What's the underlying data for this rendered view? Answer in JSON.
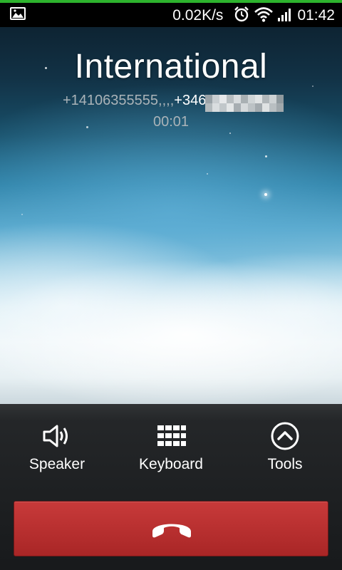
{
  "status_bar": {
    "speed": "0.02K/s",
    "time": "01:42",
    "icons": [
      "image-notification-icon",
      "alarm-icon",
      "wifi-icon",
      "signal-icon"
    ]
  },
  "call": {
    "name": "International",
    "number_visible": "+14106355555,,,,",
    "number_bright": "+346",
    "duration": "00:01"
  },
  "controls": {
    "speaker": {
      "label": "Speaker",
      "icon": "speaker-icon"
    },
    "keyboard": {
      "label": "Keyboard",
      "icon": "keypad-icon"
    },
    "tools": {
      "label": "Tools",
      "icon": "chevron-up-circle-icon"
    }
  },
  "end_call": {
    "icon": "hang-up-icon",
    "color": "#b52d2d"
  },
  "colors": {
    "accent": "#2db32d",
    "end_call": "#b52d2d"
  }
}
